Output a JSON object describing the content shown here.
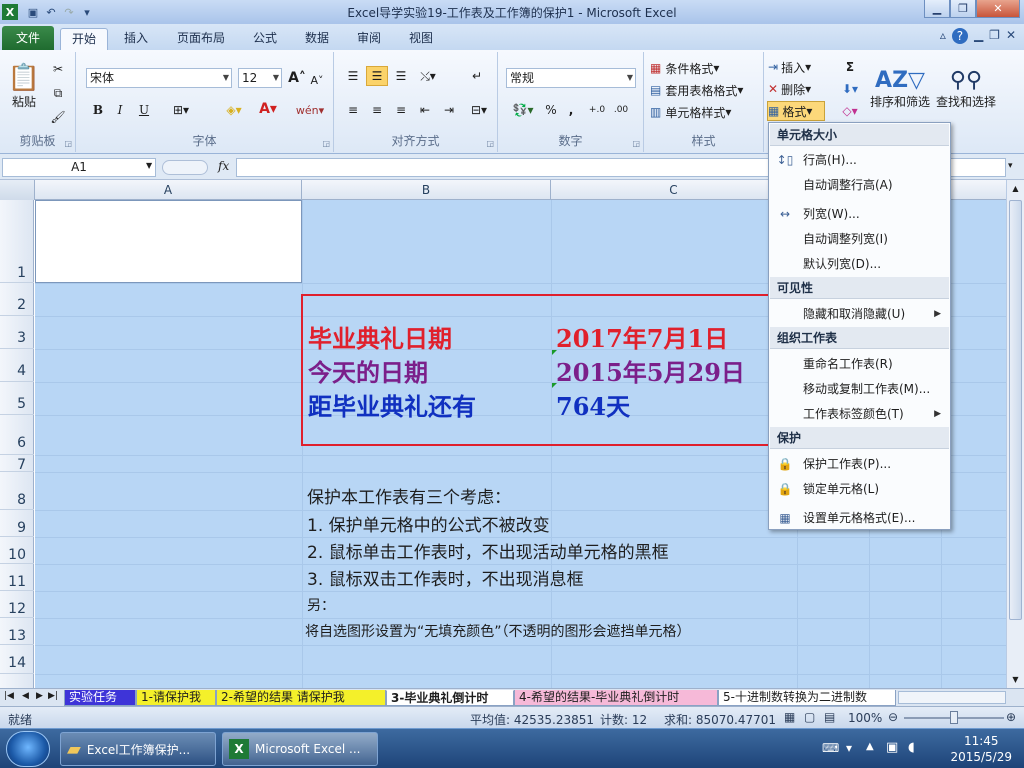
{
  "window": {
    "title": "Excel导学实验19-工作表及工作簿的保护1 - Microsoft Excel",
    "app_icon": "excel-icon"
  },
  "ribbon_tabs": [
    "文件",
    "开始",
    "插入",
    "页面布局",
    "公式",
    "数据",
    "审阅",
    "视图"
  ],
  "ribbon": {
    "clipboard": {
      "paste_label": "粘贴",
      "group_label": "剪贴板"
    },
    "font": {
      "name": "宋体",
      "size": "12",
      "group_label": "字体",
      "bold": "B",
      "italic": "I",
      "underline": "U"
    },
    "alignment": {
      "group_label": "对齐方式"
    },
    "number": {
      "format": "常规",
      "group_label": "数字",
      "percent": "%",
      "comma": ","
    },
    "styles": {
      "cond_format": "条件格式",
      "table_format": "套用表格格式",
      "cell_style": "单元格样式",
      "group_label": "样式"
    },
    "cells": {
      "insert": "插入",
      "delete": "删除",
      "format": "格式"
    },
    "editing": {
      "sigma": "Σ",
      "sort_filter": "排序和筛选",
      "find_select": "查找和选择"
    }
  },
  "formula_bar": {
    "name_box": "A1",
    "fx": "fx",
    "content": ""
  },
  "columns": [
    "A",
    "B",
    "C"
  ],
  "rows": [
    "1",
    "2",
    "3",
    "4",
    "5",
    "6",
    "7",
    "8",
    "9",
    "10",
    "11",
    "12",
    "13",
    "14"
  ],
  "cells": {
    "b3": "毕业典礼日期",
    "c3": "2017年7月1日",
    "b4": "今天的日期",
    "c4": "2015年5月29日",
    "b5": "距毕业典礼还有",
    "c5": "764天",
    "b8": "保护本工作表有三个考虑：",
    "b9": "1.  保护单元格中的公式不被改变",
    "b10": "2.  鼠标单击工作表时，不出现活动单元格的黑框",
    "b11": "3.  鼠标双击工作表时，不出现消息框",
    "b12": "另：",
    "b13": "将自选图形设置为“无填充颜色”（不透明的图形会遮挡单元格）"
  },
  "colors": {
    "graduation": "#e0202c",
    "today": "#7b1f8a",
    "remaining": "#1030c0",
    "selection": "#b8d6f5"
  },
  "sheet_tabs": [
    {
      "label": "实验任务",
      "bg": "#3e34d8",
      "fg": "#ffffff"
    },
    {
      "label": "1-请保护我",
      "bg": "#f4f02a",
      "fg": "#1e1e1e"
    },
    {
      "label": "2-希望的结果 请保护我",
      "bg": "#f4f02a",
      "fg": "#1e1e1e"
    },
    {
      "label": "3-毕业典礼倒计时",
      "bg": "#ffffff",
      "fg": "#1e1e1e"
    },
    {
      "label": "4-希望的结果-毕业典礼倒计时",
      "bg": "#f6b9d8",
      "fg": "#1e1e1e"
    },
    {
      "label": "5-十进制数转换为二进制数",
      "bg": "#ffffff",
      "fg": "#1e1e1e"
    }
  ],
  "status": {
    "mode": "就绪",
    "average": "平均值: 42535.23851",
    "count": "计数: 12",
    "sum": "求和: 85070.47701",
    "zoom": "100%"
  },
  "format_menu": {
    "sections": [
      {
        "header": "单元格大小",
        "items": [
          {
            "label": "行高(H)...",
            "icon": "row-height-icon"
          },
          {
            "label": "自动调整行高(A)",
            "icon": ""
          },
          {
            "label": "列宽(W)...",
            "icon": "column-width-icon"
          },
          {
            "label": "自动调整列宽(I)",
            "icon": ""
          },
          {
            "label": "默认列宽(D)...",
            "icon": ""
          }
        ]
      },
      {
        "header": "可见性",
        "items": [
          {
            "label": "隐藏和取消隐藏(U)",
            "icon": "",
            "submenu": true
          }
        ]
      },
      {
        "header": "组织工作表",
        "items": [
          {
            "label": "重命名工作表(R)",
            "icon": ""
          },
          {
            "label": "移动或复制工作表(M)...",
            "icon": ""
          },
          {
            "label": "工作表标签颜色(T)",
            "icon": "",
            "submenu": true
          }
        ]
      },
      {
        "header": "保护",
        "items": [
          {
            "label": "保护工作表(P)...",
            "icon": "protect-sheet-icon"
          },
          {
            "label": "锁定单元格(L)",
            "icon": "lock-icon"
          },
          {
            "label": "设置单元格格式(E)...",
            "icon": "format-cells-icon"
          }
        ]
      }
    ]
  },
  "taskbar": {
    "items": [
      {
        "label": "Excel工作簿保护...",
        "icon": "folder-icon"
      },
      {
        "label": "Microsoft Excel ...",
        "icon": "excel-icon"
      }
    ],
    "time": "11:45",
    "date": "2015/5/29"
  }
}
